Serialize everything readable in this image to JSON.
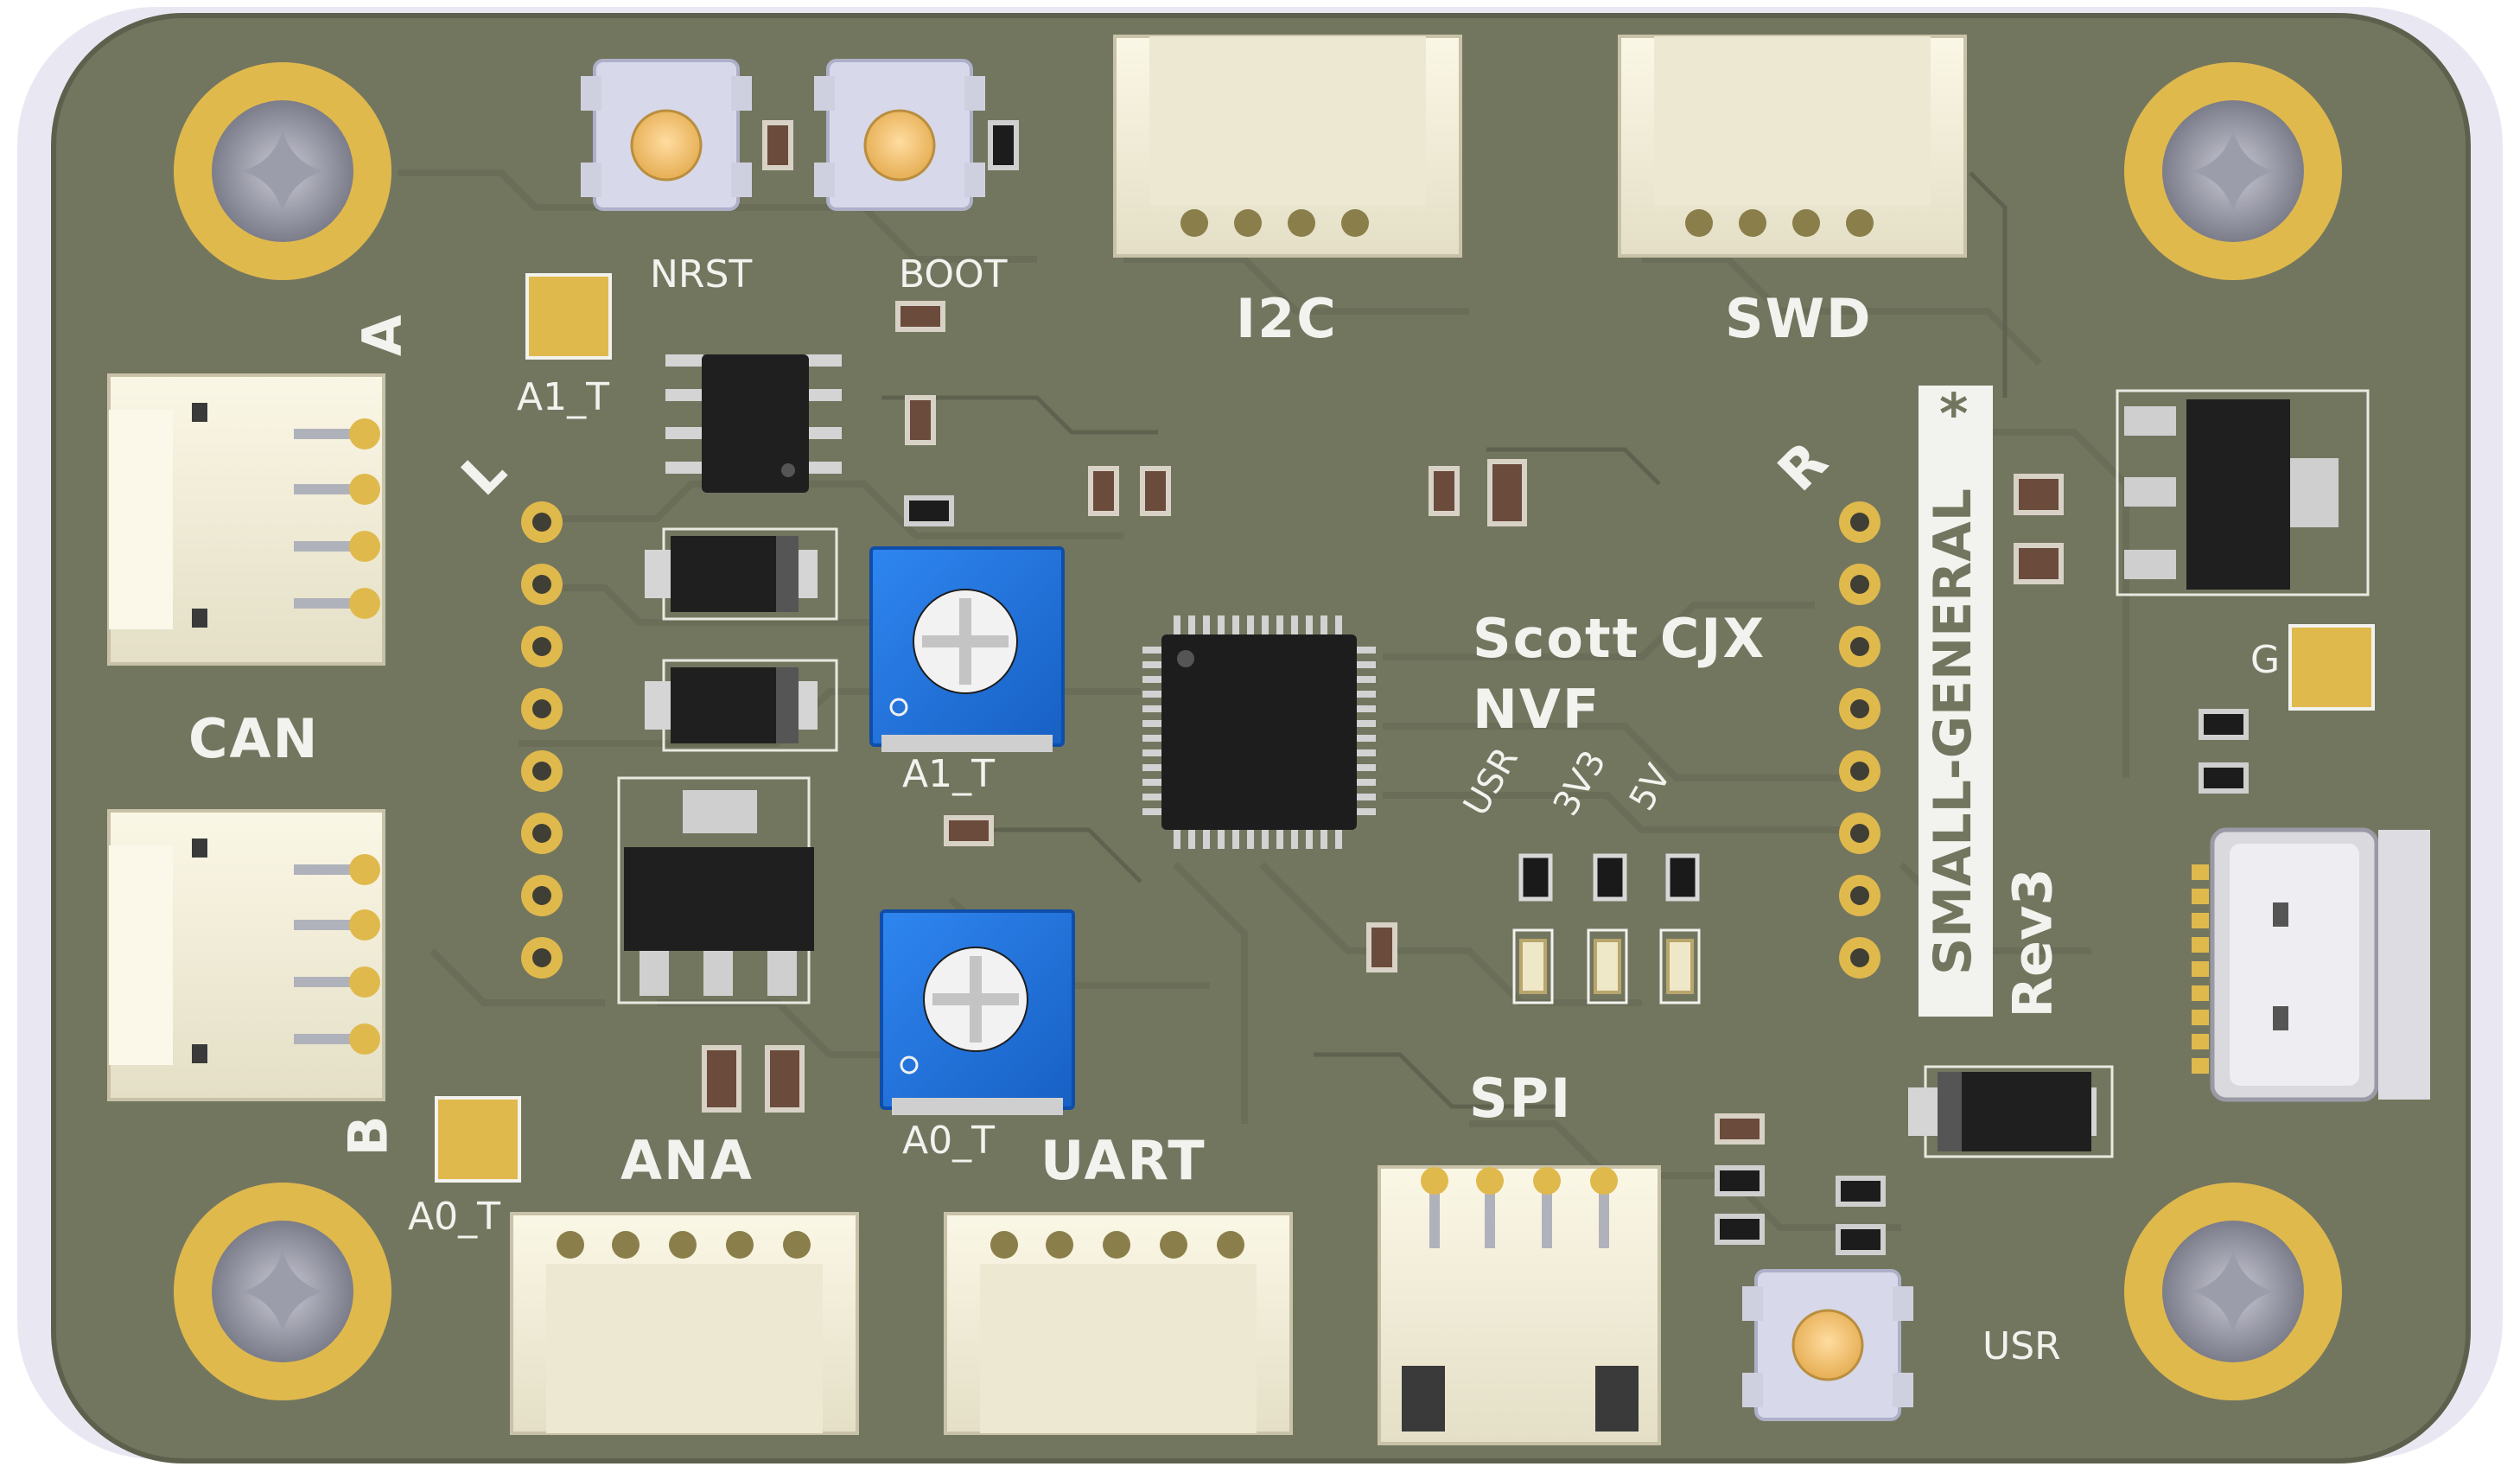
{
  "board": {
    "author": "Scott CJX",
    "project": "NVF",
    "name": "SMALL-GENERAL",
    "star": "*",
    "revision": "Rev3"
  },
  "connectors": {
    "can": "CAN",
    "can_a": "A",
    "can_b": "B",
    "i2c": "I2C",
    "swd": "SWD",
    "ana": "ANA",
    "uart": "UART",
    "spi": "SPI"
  },
  "buttons": {
    "nrst": "NRST",
    "boot": "BOOT",
    "usr": "USR"
  },
  "headers": {
    "left": "L",
    "right": "R"
  },
  "pads": {
    "a1_t": "A1_T",
    "a0_t": "A0_T",
    "g": "G"
  },
  "pots": {
    "a1_t": "A1_T",
    "a0_t": "A0_T"
  },
  "leds": {
    "usr": "USR",
    "v33": "3V3",
    "v5": "5V"
  },
  "colors": {
    "pcb": "#73765f",
    "silkscreen": "#f2f2ee",
    "gold": "#d9b24a",
    "pot_blue": "#1f73e0",
    "connector_white": "#f4f0dc"
  }
}
